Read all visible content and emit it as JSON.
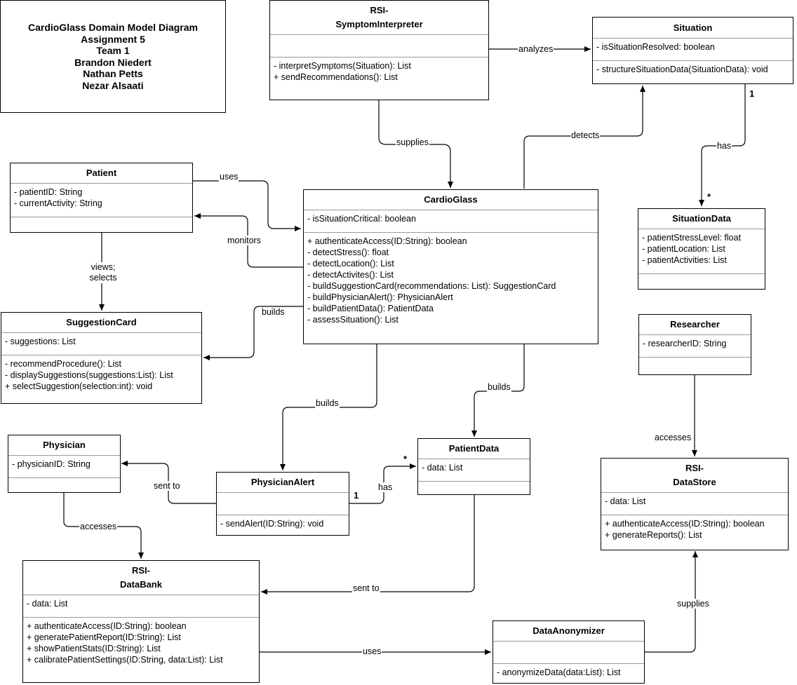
{
  "title_block": {
    "lines": [
      "CardioGlass Domain Model Diagram",
      "Assignment 5",
      "Team 1",
      "Brandon Niedert",
      "Nathan Petts",
      "Nezar Alsaati"
    ]
  },
  "classes": {
    "symptom_interpreter": {
      "name_lines": [
        "RSI-",
        "SymptomInterpreter"
      ],
      "attributes": [],
      "methods": [
        "- interpretSymptoms(Situation): List",
        "+ sendRecommendations(): List"
      ]
    },
    "situation": {
      "name_lines": [
        "Situation"
      ],
      "attributes": [
        "- isSituationResolved: boolean"
      ],
      "methods": [
        "- structureSituationData(SituationData): void"
      ]
    },
    "patient": {
      "name_lines": [
        "Patient"
      ],
      "attributes": [
        "- patientID: String",
        "- currentActivity: String"
      ],
      "methods": []
    },
    "cardioglass": {
      "name_lines": [
        "CardioGlass"
      ],
      "attributes": [
        "- isSituationCritical: boolean"
      ],
      "methods": [
        "+ authenticateAccess(ID:String): boolean",
        "- detectStress(): float",
        "- detectLocation(): List",
        "- detectActivites(): List",
        "- buildSuggestionCard(recommendations: List): SuggestionCard",
        "- buildPhysicianAlert(): PhysicianAlert",
        "- buildPatientData(): PatientData",
        "- assessSituation(): List"
      ]
    },
    "situation_data": {
      "name_lines": [
        "SituationData"
      ],
      "attributes": [
        "- patientStressLevel: float",
        "- patientLocation: List",
        "- patientActivities: List"
      ],
      "methods": []
    },
    "suggestion_card": {
      "name_lines": [
        "SuggestionCard"
      ],
      "attributes": [
        "- suggestions: List"
      ],
      "methods": [
        "- recommendProcedure(): List",
        "- displaySuggestions(suggestions:List): List",
        "+ selectSuggestion(selection:int): void"
      ]
    },
    "researcher": {
      "name_lines": [
        "Researcher"
      ],
      "attributes": [
        "- researcherID: String"
      ],
      "methods": []
    },
    "physician": {
      "name_lines": [
        "Physician"
      ],
      "attributes": [
        "- physicianID: String"
      ],
      "methods": []
    },
    "physician_alert": {
      "name_lines": [
        "PhysicianAlert"
      ],
      "attributes": [],
      "methods": [
        "- sendAlert(ID:String): void"
      ]
    },
    "patient_data": {
      "name_lines": [
        "PatientData"
      ],
      "attributes": [
        "- data: List"
      ],
      "methods": []
    },
    "datastore": {
      "name_lines": [
        "RSI-",
        "DataStore"
      ],
      "attributes": [
        "- data: List"
      ],
      "methods": [
        "+ authenticateAccess(ID:String): boolean",
        "+ generateReports(): List"
      ]
    },
    "databank": {
      "name_lines": [
        "RSI-",
        "DataBank"
      ],
      "attributes": [
        "- data: List"
      ],
      "methods": [
        "+ authenticateAccess(ID:String): boolean",
        "+ generatePatientReport(ID:String): List",
        "+ showPatientStats(ID:String): List",
        "+ calibratePatientSettings(ID:String, data:List): List"
      ]
    },
    "anonymizer": {
      "name_lines": [
        "DataAnonymizer"
      ],
      "attributes": [],
      "methods": [
        "- anonymizeData(data:List): List"
      ]
    }
  },
  "relations": [
    {
      "id": "analyzes",
      "from": "RSI-SymptomInterpreter",
      "to": "Situation",
      "label": "analyzes"
    },
    {
      "id": "supplies1",
      "from": "RSI-SymptomInterpreter",
      "to": "CardioGlass",
      "label": "supplies"
    },
    {
      "id": "detects",
      "from": "CardioGlass",
      "to": "Situation",
      "label": "detects"
    },
    {
      "id": "has1",
      "from": "Situation",
      "to": "SituationData",
      "label": "has",
      "from_mult": "1",
      "to_mult": "*"
    },
    {
      "id": "uses1",
      "from": "Patient",
      "to": "CardioGlass",
      "label": "uses"
    },
    {
      "id": "monitors",
      "from": "CardioGlass",
      "to": "Patient",
      "label": "monitors"
    },
    {
      "id": "views",
      "from": "Patient",
      "to": "SuggestionCard",
      "label": "views; selects"
    },
    {
      "id": "builds1",
      "from": "CardioGlass",
      "to": "SuggestionCard",
      "label": "builds"
    },
    {
      "id": "builds2",
      "from": "CardioGlass",
      "to": "PhysicianAlert",
      "label": "builds"
    },
    {
      "id": "builds3",
      "from": "CardioGlass",
      "to": "PatientData",
      "label": "builds"
    },
    {
      "id": "sentto1",
      "from": "PhysicianAlert",
      "to": "Physician",
      "label": "sent to"
    },
    {
      "id": "has2",
      "from": "PhysicianAlert",
      "to": "PatientData",
      "label": "has",
      "from_mult": "1",
      "to_mult": "*"
    },
    {
      "id": "accesses1",
      "from": "Physician",
      "to": "RSI-DataBank",
      "label": "accesses"
    },
    {
      "id": "sentto2",
      "from": "PatientData",
      "to": "RSI-DataBank",
      "label": "sent to"
    },
    {
      "id": "uses2",
      "from": "RSI-DataBank",
      "to": "DataAnonymizer",
      "label": "uses"
    },
    {
      "id": "supplies2",
      "from": "DataAnonymizer",
      "to": "RSI-DataStore",
      "label": "supplies"
    },
    {
      "id": "accesses2",
      "from": "Researcher",
      "to": "RSI-DataStore",
      "label": "accesses"
    }
  ]
}
